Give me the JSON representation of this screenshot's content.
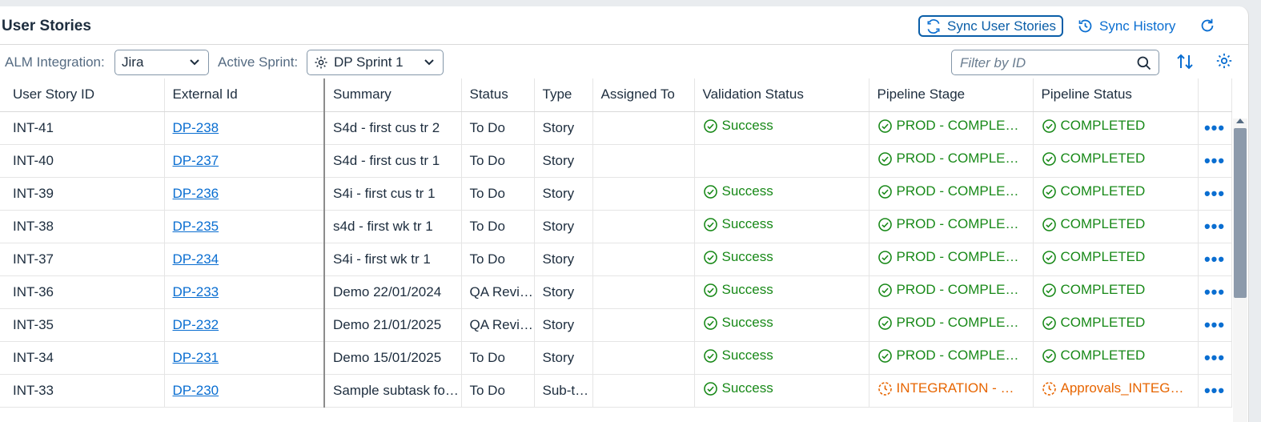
{
  "header": {
    "title": "User Stories",
    "sync_label": "Sync User Stories",
    "history_label": "Sync History"
  },
  "toolbar": {
    "alm_label": "ALM Integration:",
    "alm_value": "Jira",
    "sprint_label": "Active Sprint:",
    "sprint_value": "DP Sprint 1",
    "filter_placeholder": "Filter by ID"
  },
  "table": {
    "columns": [
      "User Story ID",
      "External Id",
      "Summary",
      "Status",
      "Type",
      "Assigned To",
      "Validation Status",
      "Pipeline Stage",
      "Pipeline Status"
    ],
    "rows": [
      {
        "id": "INT-41",
        "ext": "DP-238",
        "summary": "S4d - first cus tr 2",
        "status": "To Do",
        "type": "Story",
        "assigned": "",
        "validation": "Success",
        "stage": "PROD - COMPLETED",
        "pstatus": "COMPLETED",
        "state": "ok"
      },
      {
        "id": "INT-40",
        "ext": "DP-237",
        "summary": "S4d - first cus tr 1",
        "status": "To Do",
        "type": "Story",
        "assigned": "",
        "validation": "",
        "stage": "PROD - COMPLETED",
        "pstatus": "COMPLETED",
        "state": "ok"
      },
      {
        "id": "INT-39",
        "ext": "DP-236",
        "summary": "S4i - first cus tr 1",
        "status": "To Do",
        "type": "Story",
        "assigned": "",
        "validation": "Success",
        "stage": "PROD - COMPLETED",
        "pstatus": "COMPLETED",
        "state": "ok"
      },
      {
        "id": "INT-38",
        "ext": "DP-235",
        "summary": "s4d - first wk tr 1",
        "status": "To Do",
        "type": "Story",
        "assigned": "",
        "validation": "Success",
        "stage": "PROD - COMPLETED",
        "pstatus": "COMPLETED",
        "state": "ok"
      },
      {
        "id": "INT-37",
        "ext": "DP-234",
        "summary": "S4i - first wk tr 1",
        "status": "To Do",
        "type": "Story",
        "assigned": "",
        "validation": "Success",
        "stage": "PROD - COMPLETED",
        "pstatus": "COMPLETED",
        "state": "ok"
      },
      {
        "id": "INT-36",
        "ext": "DP-233",
        "summary": "Demo 22/01/2024",
        "status": "QA Review",
        "type": "Story",
        "assigned": "",
        "validation": "Success",
        "stage": "PROD - COMPLETED",
        "pstatus": "COMPLETED",
        "state": "ok"
      },
      {
        "id": "INT-35",
        "ext": "DP-232",
        "summary": "Demo 21/01/2025",
        "status": "QA Review",
        "type": "Story",
        "assigned": "",
        "validation": "Success",
        "stage": "PROD - COMPLETED",
        "pstatus": "COMPLETED",
        "state": "ok"
      },
      {
        "id": "INT-34",
        "ext": "DP-231",
        "summary": "Demo 15/01/2025",
        "status": "To Do",
        "type": "Story",
        "assigned": "",
        "validation": "Success",
        "stage": "PROD - COMPLETED",
        "pstatus": "COMPLETED",
        "state": "ok"
      },
      {
        "id": "INT-33",
        "ext": "DP-230",
        "summary": "Sample subtask for testing",
        "status": "To Do",
        "type": "Sub-task",
        "assigned": "",
        "validation": "Success",
        "stage": "INTEGRATION - WAITING",
        "pstatus": "Approvals_INTEGRATION",
        "state": "warn"
      }
    ]
  },
  "more_actions": "•••",
  "colors": {
    "accent": "#0a6ed1",
    "success": "#188918",
    "warning": "#e76500"
  }
}
